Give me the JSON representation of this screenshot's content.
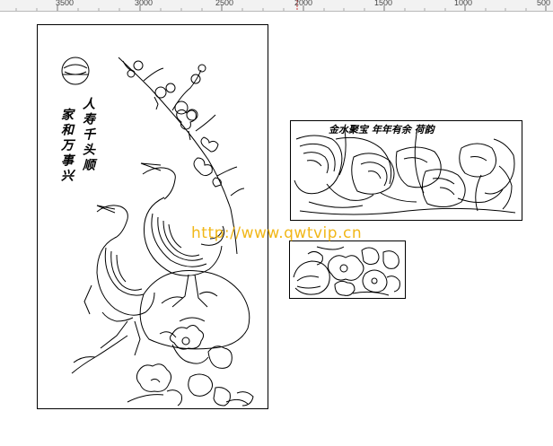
{
  "ruler": {
    "ticks": [
      {
        "label": "3500"
      },
      {
        "label": "3000"
      },
      {
        "label": "2500"
      },
      {
        "label": "2000"
      },
      {
        "label": "1500"
      },
      {
        "label": "1000"
      },
      {
        "label": "500"
      }
    ]
  },
  "panels": {
    "crane_panel": {
      "inscription_col1": "人寿千头顺",
      "inscription_col2": "家和万事兴"
    },
    "lotus_panel": {
      "inscription": "金水聚宝 年年有余 荷韵"
    }
  },
  "watermark": "http://www.qwtvip.cn"
}
